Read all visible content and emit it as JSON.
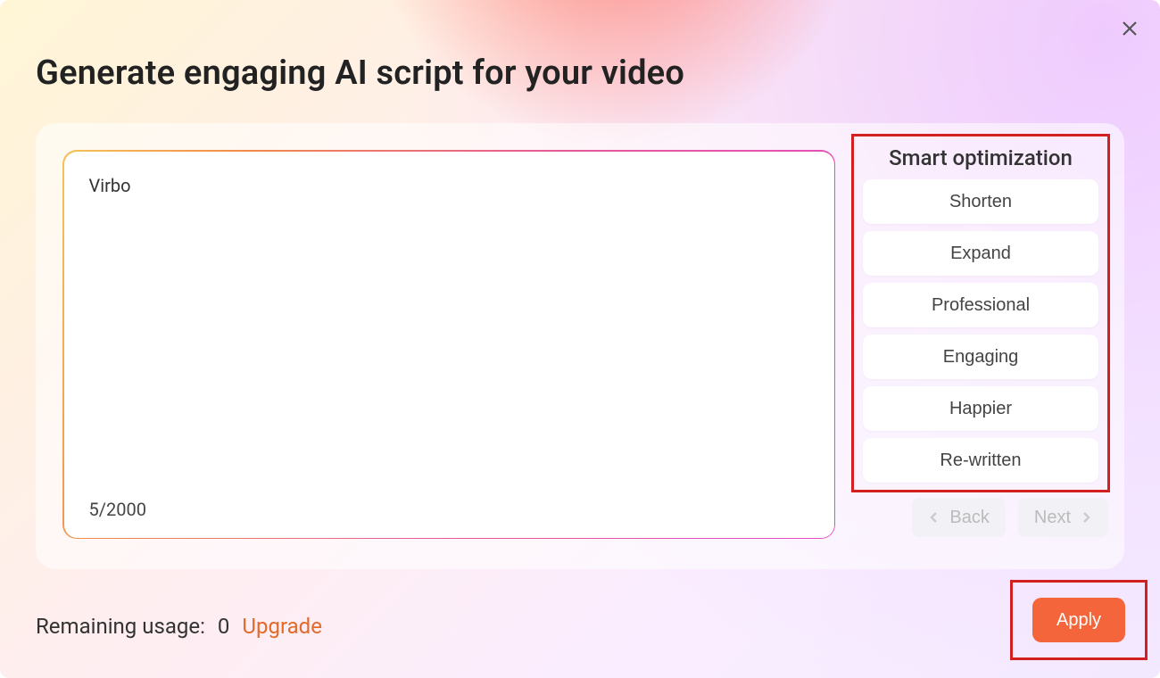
{
  "title": "Generate engaging AI script for your video",
  "editor": {
    "text": "Virbo",
    "char_count": "5/2000"
  },
  "smart_optimization": {
    "title": "Smart optimization",
    "options": [
      "Shorten",
      "Expand",
      "Professional",
      "Engaging",
      "Happier",
      "Re-written"
    ]
  },
  "nav": {
    "back": "Back",
    "next": "Next"
  },
  "footer": {
    "remaining_label": "Remaining usage:",
    "remaining_value": "0",
    "upgrade": "Upgrade"
  },
  "apply": "Apply"
}
